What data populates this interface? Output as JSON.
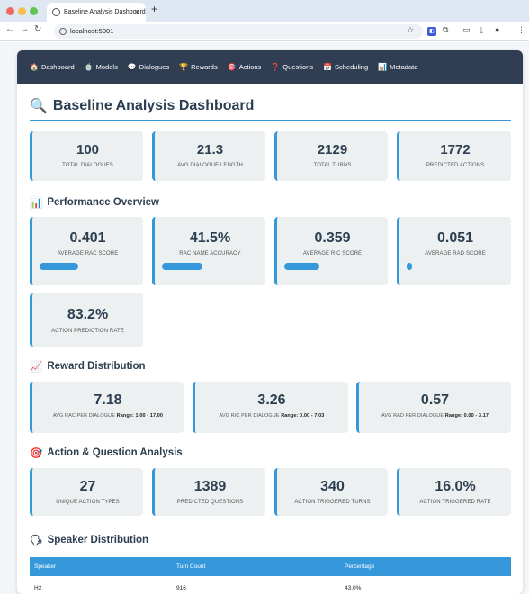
{
  "browser": {
    "tab_title": "Baseline Analysis Dashboard",
    "url": "localhost:5001"
  },
  "nav": [
    {
      "icon": "🏠",
      "label": "Dashboard"
    },
    {
      "icon": "🍵",
      "label": "Models"
    },
    {
      "icon": "💬",
      "label": "Dialogues"
    },
    {
      "icon": "🏆",
      "label": "Rewards"
    },
    {
      "icon": "🎯",
      "label": "Actions"
    },
    {
      "icon": "❓",
      "label": "Questions"
    },
    {
      "icon": "📅",
      "label": "Scheduling"
    },
    {
      "icon": "📊",
      "label": "Metadata"
    }
  ],
  "page_title": "Baseline Analysis Dashboard",
  "summary": [
    {
      "value": "100",
      "label": "TOTAL DIALOGUES"
    },
    {
      "value": "21.3",
      "label": "AVG DIALOGUE LENGTH"
    },
    {
      "value": "2129",
      "label": "TOTAL TURNS"
    },
    {
      "value": "1772",
      "label": "PREDICTED ACTIONS"
    }
  ],
  "performance": {
    "title": "Performance Overview",
    "cards": [
      {
        "value": "0.401",
        "label": "AVERAGE RAC SCORE",
        "fraction": 0.401
      },
      {
        "value": "41.5%",
        "label": "RAC NAME ACCURACY",
        "fraction": 0.415
      },
      {
        "value": "0.359",
        "label": "AVERAGE RIC SCORE",
        "fraction": 0.359
      },
      {
        "value": "0.051",
        "label": "AVERAGE RAD SCORE",
        "fraction": 0.051
      }
    ],
    "extra": {
      "value": "83.2%",
      "label": "ACTION PREDICTION RATE"
    }
  },
  "reward": {
    "title": "Reward Distribution",
    "cards": [
      {
        "value": "7.18",
        "label": "AVG RAC PER DIALOGUE",
        "range": "Range: 1.00 - 17.00"
      },
      {
        "value": "3.26",
        "label": "AVG RIC PER DIALOGUE",
        "range": "Range: 0.00 - 7.03"
      },
      {
        "value": "0.57",
        "label": "AVG RAD PER DIALOGUE",
        "range": "Range: 0.00 - 3.17"
      }
    ]
  },
  "action": {
    "title": "Action & Question Analysis",
    "cards": [
      {
        "value": "27",
        "label": "UNIQUE ACTION TYPES"
      },
      {
        "value": "1389",
        "label": "PREDICTED QUESTIONS"
      },
      {
        "value": "340",
        "label": "ACTION TRIGGERED TURNS"
      },
      {
        "value": "16.0%",
        "label": "ACTION TRIGGERED RATE"
      }
    ]
  },
  "speaker": {
    "title": "Speaker Distribution",
    "columns": [
      "Speaker",
      "Turn Count",
      "Percentage"
    ],
    "rows": [
      [
        "H2",
        "916",
        "43.0%"
      ]
    ]
  },
  "colors": {
    "accent": "#3498db",
    "nav_bg": "#2f3e52",
    "card_bg": "#ecf0f1",
    "heading": "#2c3e50"
  }
}
